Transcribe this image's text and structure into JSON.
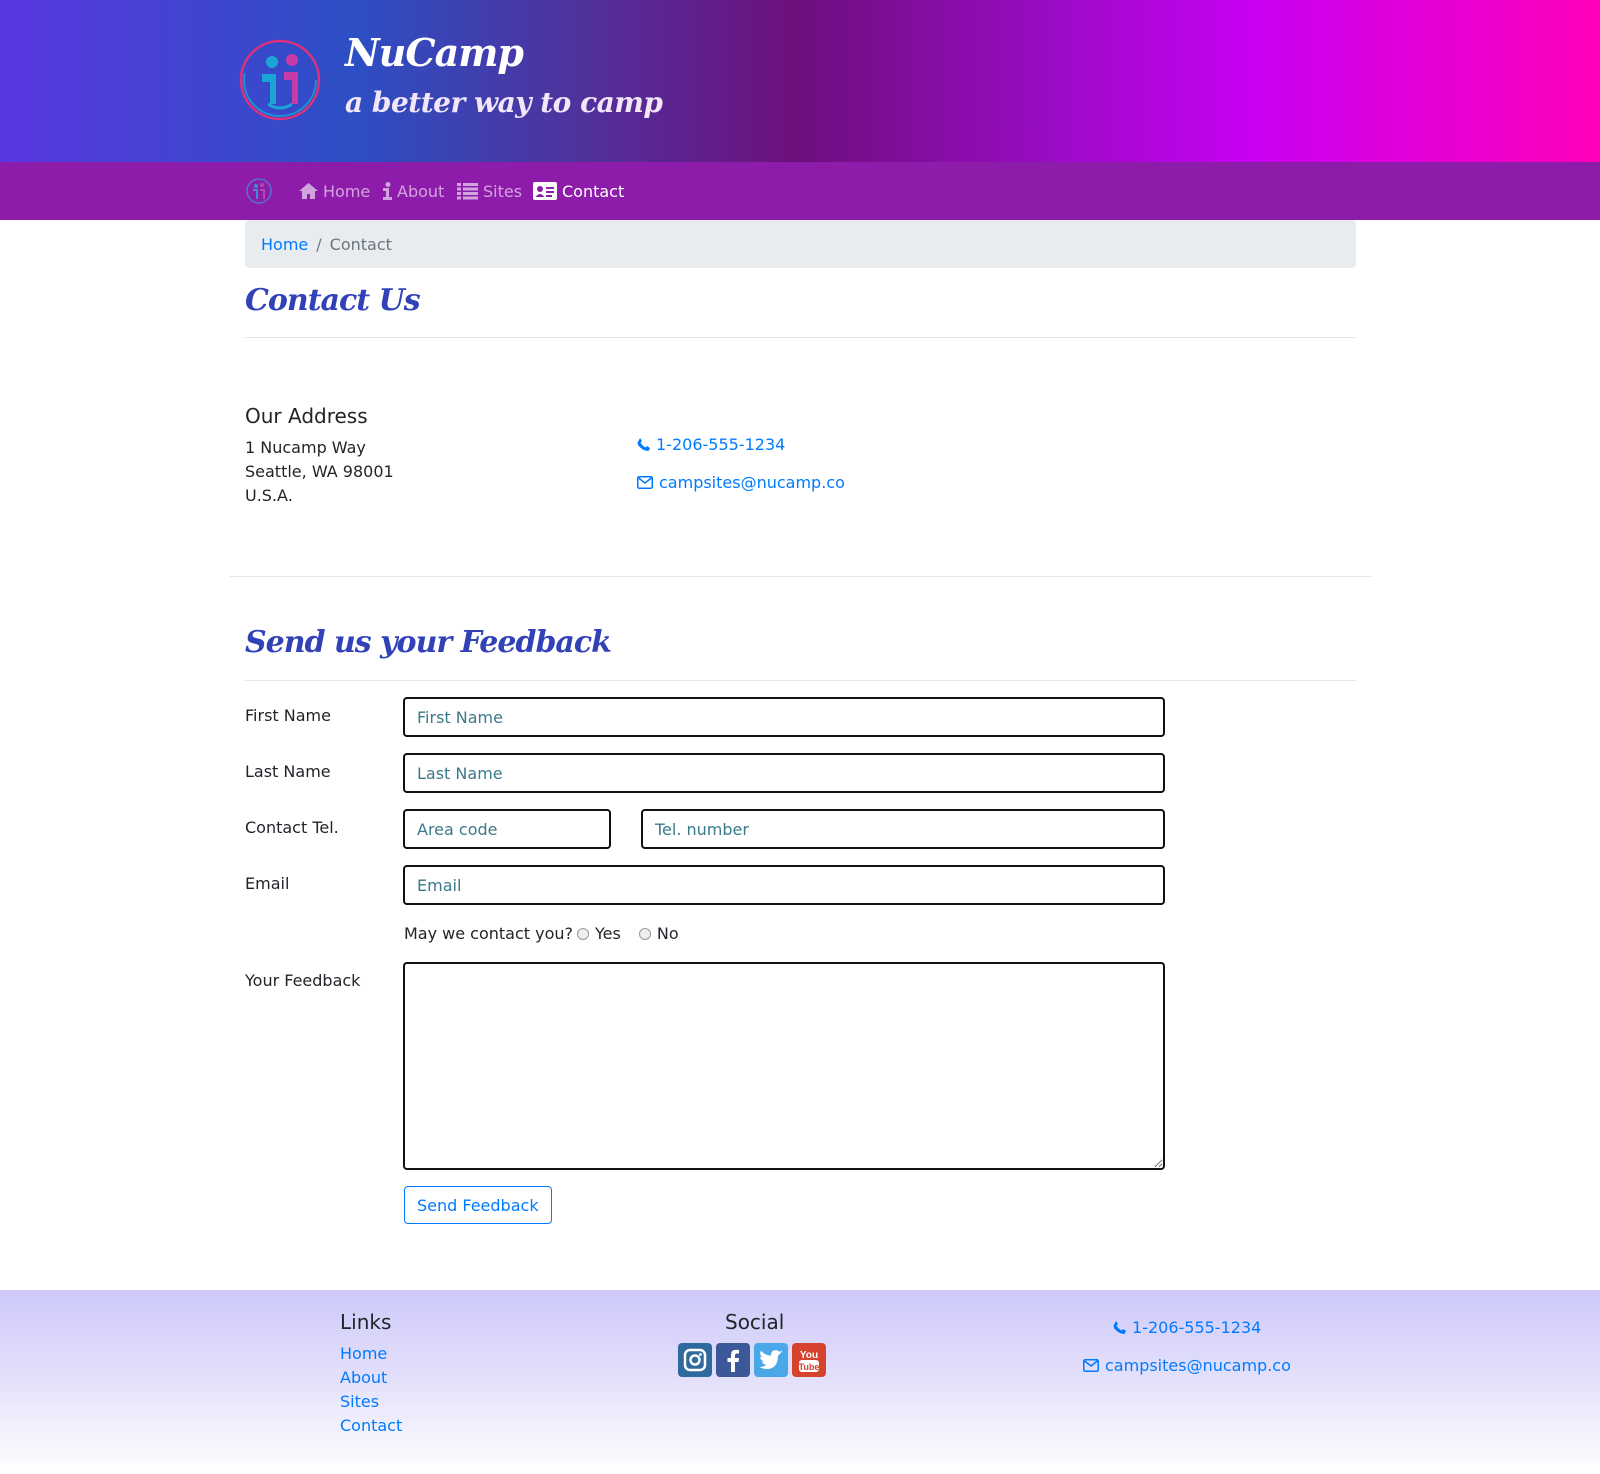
{
  "brand": {
    "title": "NuCamp",
    "subtitle": "a better way to camp"
  },
  "nav": {
    "items": [
      {
        "label": "Home",
        "icon": "home-icon"
      },
      {
        "label": "About",
        "icon": "info-icon"
      },
      {
        "label": "Sites",
        "icon": "list-icon"
      },
      {
        "label": "Contact",
        "icon": "address-card-icon",
        "active": true
      }
    ]
  },
  "breadcrumb": {
    "home": "Home",
    "separator": "/",
    "current": "Contact"
  },
  "contact": {
    "heading": "Contact Us",
    "address_title": "Our Address",
    "address_lines": [
      "1 Nucamp Way",
      "Seattle, WA 98001",
      "U.S.A."
    ],
    "phone": "1-206-555-1234",
    "email": "campsites@nucamp.co"
  },
  "feedback": {
    "heading": "Send us your Feedback",
    "labels": {
      "first_name": "First Name",
      "last_name": "Last Name",
      "tel": "Contact Tel.",
      "email": "Email",
      "feedback": "Your Feedback"
    },
    "placeholders": {
      "first_name": "First Name",
      "last_name": "Last Name",
      "area_code": "Area code",
      "tel_number": "Tel. number",
      "email": "Email"
    },
    "contact_question": "May we contact you?",
    "radio_yes": "Yes",
    "radio_no": "No",
    "submit": "Send Feedback"
  },
  "footer": {
    "links_title": "Links",
    "links": [
      "Home",
      "About",
      "Sites",
      "Contact"
    ],
    "social_title": "Social",
    "social_icons": [
      "instagram-icon",
      "facebook-icon",
      "twitter-icon",
      "youtube-icon"
    ],
    "phone": "1-206-555-1234",
    "email": "campsites@nucamp.co"
  },
  "colors": {
    "heading": "#3141b8",
    "link": "#007bff",
    "navbar": "#8e1cab",
    "footer": "#cec9fa"
  }
}
